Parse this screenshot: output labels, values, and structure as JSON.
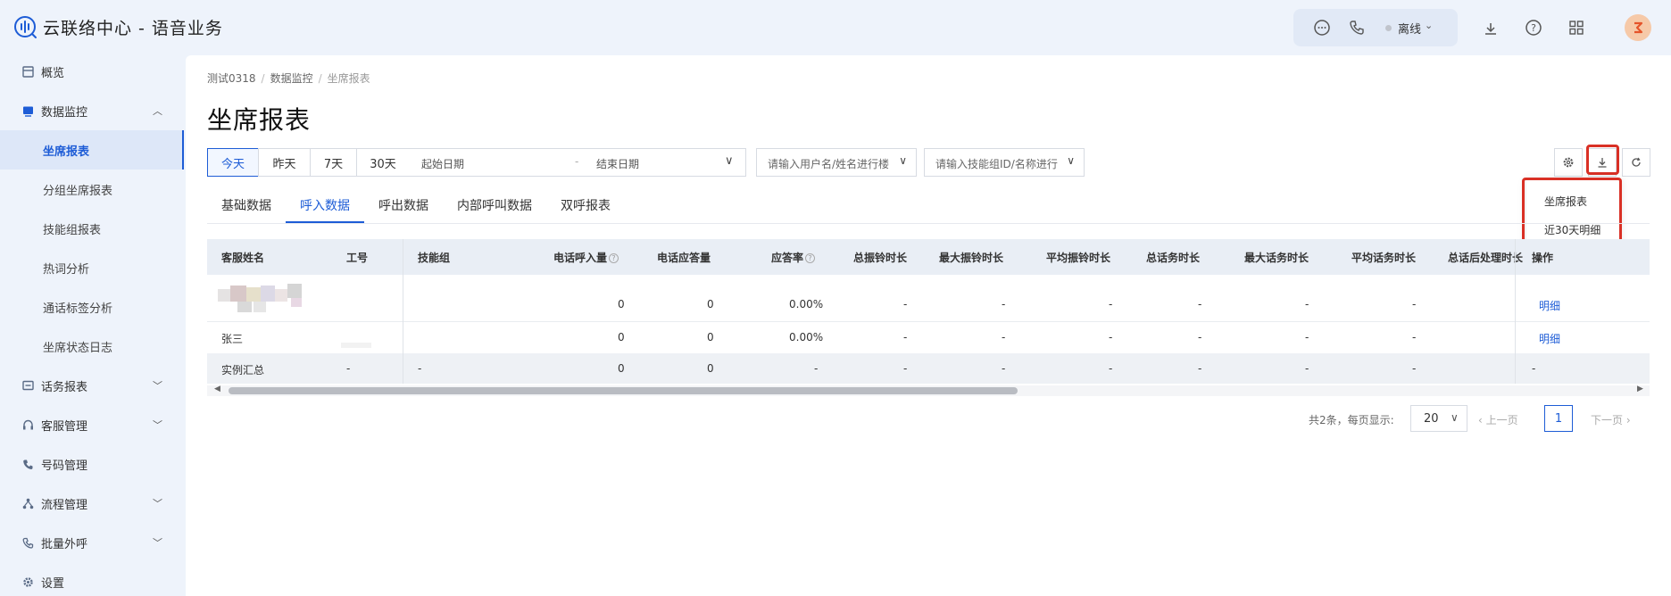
{
  "app": {
    "title": "云联络中心 - 语音业务"
  },
  "header": {
    "status_label": "离线",
    "icons": [
      "chat-icon",
      "phone-icon",
      "download-icon",
      "help-icon",
      "grid-icon"
    ]
  },
  "sidebar": {
    "items": [
      {
        "label": "概览",
        "icon": "overview-icon"
      },
      {
        "label": "数据监控",
        "icon": "monitor-icon",
        "expanded": true
      },
      {
        "label": "话务报表",
        "icon": "report-icon"
      },
      {
        "label": "客服管理",
        "icon": "headset-icon"
      },
      {
        "label": "号码管理",
        "icon": "phone-icon"
      },
      {
        "label": "流程管理",
        "icon": "flow-icon"
      },
      {
        "label": "批量外呼",
        "icon": "outbound-icon"
      },
      {
        "label": "设置",
        "icon": "settings-icon"
      }
    ],
    "subitems": [
      {
        "label": "坐席报表",
        "active": true
      },
      {
        "label": "分组坐席报表"
      },
      {
        "label": "技能组报表"
      },
      {
        "label": "热词分析"
      },
      {
        "label": "通话标签分析"
      },
      {
        "label": "坐席状态日志"
      }
    ]
  },
  "breadcrumb": {
    "items": [
      "测试0318",
      "数据监控",
      "坐席报表"
    ]
  },
  "page": {
    "title": "坐席报表"
  },
  "filters": {
    "quick_dates": [
      "今天",
      "昨天",
      "7天",
      "30天"
    ],
    "start_placeholder": "起始日期",
    "range_sep": "-",
    "end_placeholder": "结束日期",
    "user_placeholder": "请输入用户名/姓名进行楼",
    "skill_placeholder": "请输入技能组ID/名称进行"
  },
  "export_menu": {
    "items": [
      "坐席报表",
      "近30天明细"
    ]
  },
  "tabs": [
    "基础数据",
    "呼入数据",
    "呼出数据",
    "内部呼叫数据",
    "双呼报表"
  ],
  "table": {
    "columns": [
      "客服姓名",
      "工号",
      "技能组",
      "电话呼入量",
      "电话应答量",
      "应答率",
      "总振铃时长",
      "最大振铃时长",
      "平均振铃时长",
      "总话务时长",
      "最大话务时长",
      "平均话务时长",
      "总话后处理时长",
      "操作"
    ],
    "rows": [
      {
        "name": "",
        "id": "",
        "skill": "",
        "calls_in": "0",
        "answered": "0",
        "rate": "0.00%",
        "total_ring": "-",
        "max_ring": "-",
        "avg_ring": "-",
        "total_talk": "-",
        "max_talk": "-",
        "avg_talk": "-",
        "action": "明细"
      },
      {
        "name": "张三",
        "id": "",
        "skill": "",
        "calls_in": "0",
        "answered": "0",
        "rate": "0.00%",
        "total_ring": "-",
        "max_ring": "-",
        "avg_ring": "-",
        "total_talk": "-",
        "max_talk": "-",
        "avg_talk": "-",
        "action": "明细"
      }
    ],
    "summary": {
      "name": "实例汇总",
      "id": "-",
      "skill": "-",
      "calls_in": "0",
      "answered": "0",
      "rate": "-",
      "total_ring": "-",
      "max_ring": "-",
      "avg_ring": "-",
      "total_talk": "-",
      "max_talk": "-",
      "avg_talk": "-",
      "action": "-"
    }
  },
  "pagination": {
    "total_text": "共2条，每页显示:",
    "page_size": "20",
    "prev_label": "上一页",
    "current_page": "1",
    "next_label": "下一页"
  },
  "colors": {
    "accent": "#1d5cd6",
    "highlight": "#d93025",
    "sidebar_bg": "#eef3fb"
  }
}
